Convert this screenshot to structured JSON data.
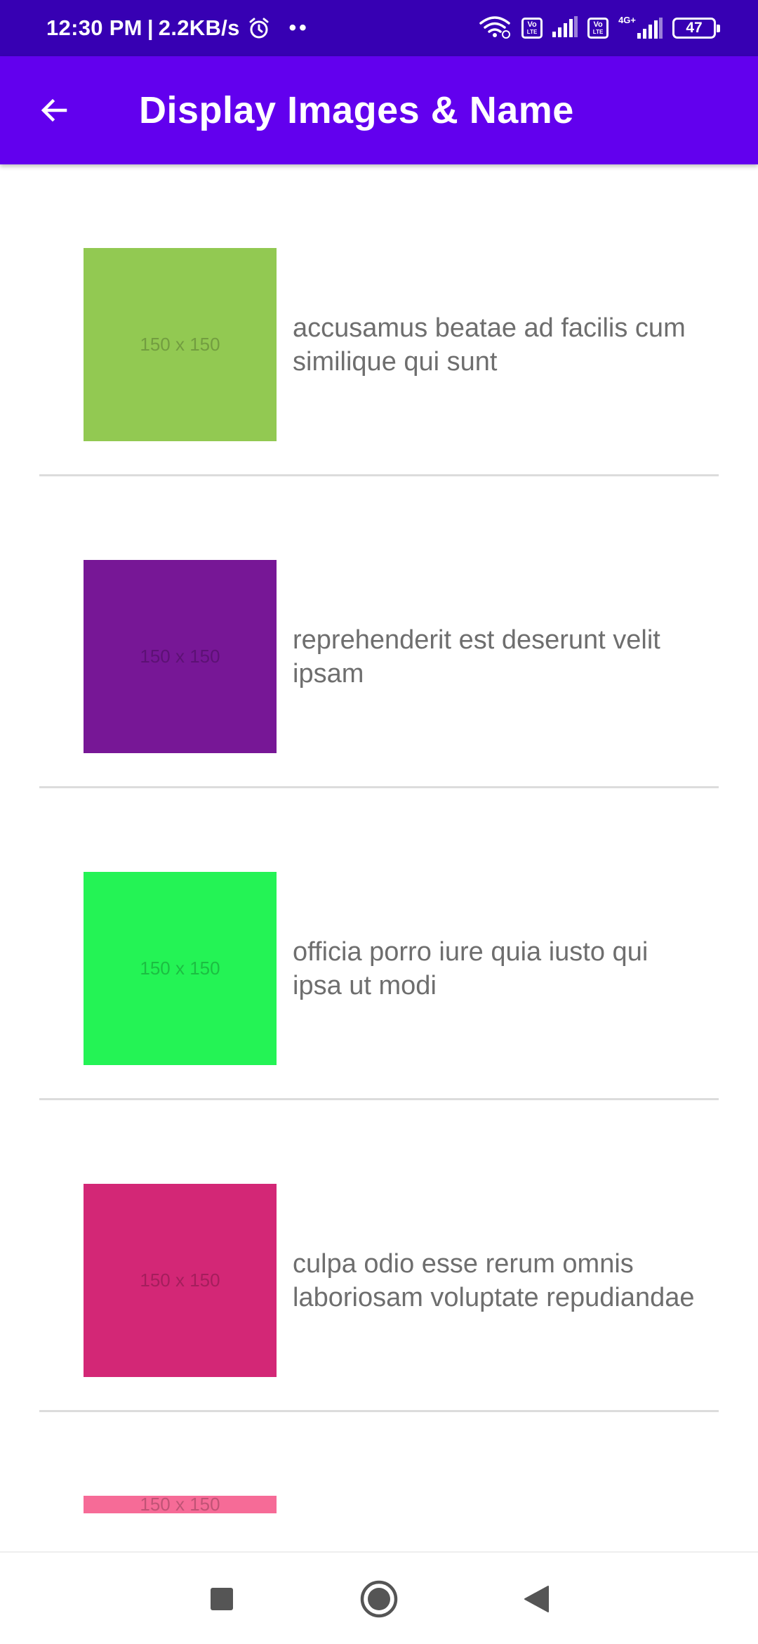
{
  "status_bar": {
    "time": "12:30 PM",
    "separator": "|",
    "net_speed": "2.2KB/s",
    "dots": "••",
    "volte1_top": "Vo",
    "volte1_bottom": "LTE",
    "volte2_top": "Vo",
    "volte2_bottom": "LTE",
    "network_type": "4G+",
    "battery": "47",
    "icons": [
      "alarm-icon",
      "wifi-icon",
      "signal-icon",
      "battery-icon"
    ]
  },
  "app_bar": {
    "title": "Display Images & Name",
    "back_icon": "arrow-back-icon",
    "color": "#6200ee"
  },
  "items": [
    {
      "thumb_label": "150 x 150",
      "color": "#92c952",
      "text": "accusamus beatae ad facilis cum similique qui sunt"
    },
    {
      "thumb_label": "150 x 150",
      "color": "#771796",
      "text": "reprehenderit est deserunt velit ipsam"
    },
    {
      "thumb_label": "150 x 150",
      "color": "#24f355",
      "text": "officia porro iure quia iusto qui ipsa ut modi"
    },
    {
      "thumb_label": "150 x 150",
      "color": "#d32776",
      "text": "culpa odio esse rerum omnis laboriosam voluptate repudiandae"
    },
    {
      "thumb_label": "150 x 150",
      "color": "#f66b97",
      "text": ""
    }
  ],
  "nav_bar": {
    "buttons": [
      "recents-square-icon",
      "home-circle-icon",
      "back-triangle-icon"
    ]
  },
  "colors": {
    "status_bar": "#3700b3",
    "app_bar": "#6200ee",
    "item_text": "#6e6e6e",
    "divider": "#dcdcdc"
  }
}
